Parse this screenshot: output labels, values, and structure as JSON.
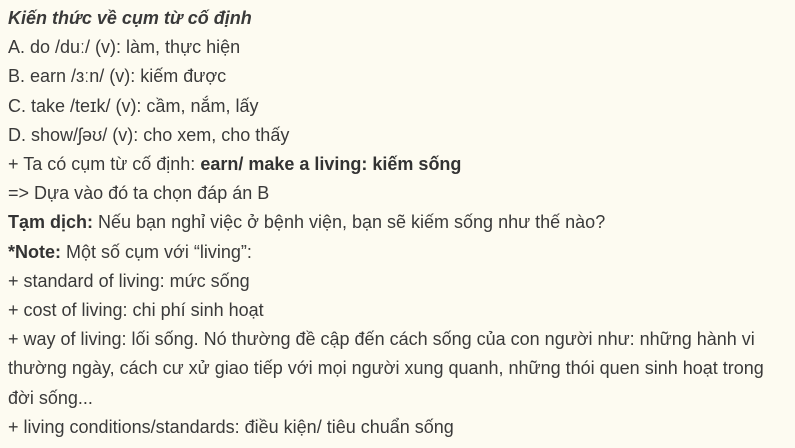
{
  "heading": "Kiến thức về cụm từ cố định",
  "options": [
    "A. do /duː/ (v): làm, thực hiện",
    "B. earn /ɜːn/ (v): kiếm được",
    "C. take /teɪk/ (v): cầm, nắm, lấy",
    "D. show/ʃəʊ/ (v): cho xem, cho thấy"
  ],
  "phrase": {
    "prefix": "+ Ta có cụm từ cố định: ",
    "bold": "earn/ make a living: kiếm sống"
  },
  "conclusion": "=> Dựa vào đó ta chọn đáp án B",
  "translation": {
    "label": "Tạm dịch:",
    "text": " Nếu bạn nghỉ việc ở bệnh viện, bạn sẽ kiếm sống như thế nào?"
  },
  "note": {
    "label": "*Note:",
    "text": " Một số cụm với “living”:"
  },
  "items": [
    "+ standard of living: mức sống",
    "+ cost of living: chi phí sinh hoạt",
    "+ way of living: lối sống. Nó thường đề cập đến cách sống của con người như: những hành vi thường ngày, cách cư xử giao tiếp với mọi người xung quanh, những thói quen sinh hoạt trong đời sống...",
    "+ living conditions/standards: điều kiện/ tiêu chuẩn sống"
  ]
}
